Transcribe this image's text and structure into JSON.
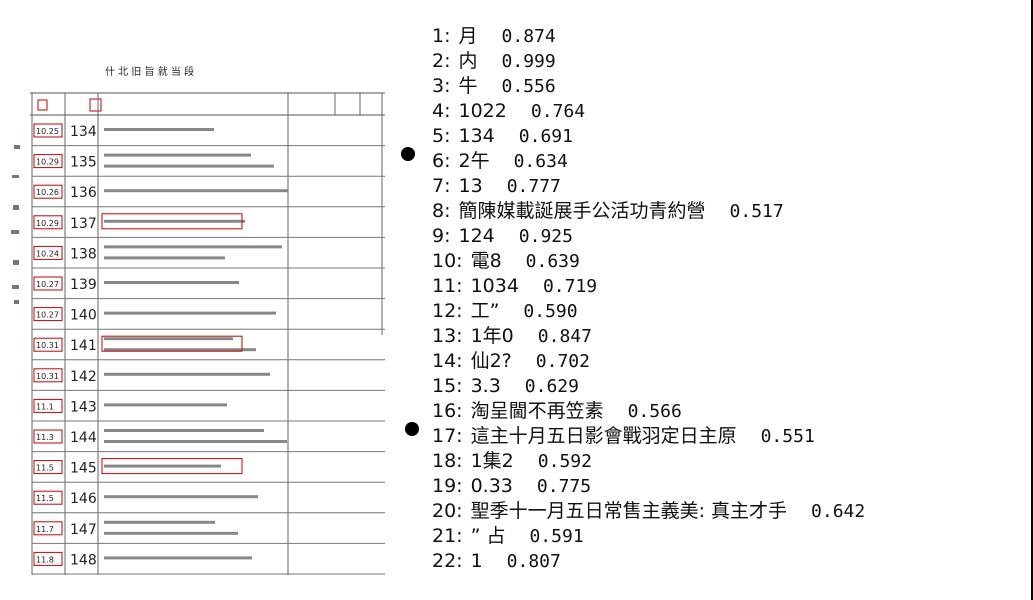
{
  "document": {
    "title_row": "什 北 旧 旨 就 当 段",
    "rows": [
      {
        "date": "10.25",
        "num": "134"
      },
      {
        "date": "10.29",
        "num": "135"
      },
      {
        "date": "10.26",
        "num": "136"
      },
      {
        "date": "10.29",
        "num": "137"
      },
      {
        "date": "10.24",
        "num": "138"
      },
      {
        "date": "10.27",
        "num": "139"
      },
      {
        "date": "10.27",
        "num": "140"
      },
      {
        "date": "10.31",
        "num": "141"
      },
      {
        "date": "10.31",
        "num": "142"
      },
      {
        "date": "11.1",
        "num": "143"
      },
      {
        "date": "11.3",
        "num": "144"
      },
      {
        "date": "11.5",
        "num": "145"
      },
      {
        "date": "11.5",
        "num": "146"
      },
      {
        "date": "11.7",
        "num": "147"
      },
      {
        "date": "11.8",
        "num": "148"
      }
    ]
  },
  "results": [
    {
      "idx": "1:",
      "text": "月",
      "score": "0.874"
    },
    {
      "idx": "2:",
      "text": "内",
      "score": "0.999"
    },
    {
      "idx": "3:",
      "text": "牛",
      "score": "0.556"
    },
    {
      "idx": "4:",
      "text": "1022",
      "score": "0.764"
    },
    {
      "idx": "5:",
      "text": "134",
      "score": "0.691"
    },
    {
      "idx": "6:",
      "text": "2午",
      "score": "0.634"
    },
    {
      "idx": "7:",
      "text": "13",
      "score": "0.777"
    },
    {
      "idx": "8:",
      "text": "簡陳媒載誕展手公活功青約營",
      "score": "0.517"
    },
    {
      "idx": "9:",
      "text": "124",
      "score": "0.925"
    },
    {
      "idx": "10:",
      "text": "電8",
      "score": "0.639"
    },
    {
      "idx": "11:",
      "text": "1034",
      "score": "0.719"
    },
    {
      "idx": "12:",
      "text": "工”",
      "score": "0.590"
    },
    {
      "idx": "13:",
      "text": "1年0",
      "score": "0.847"
    },
    {
      "idx": "14:",
      "text": "仙2?",
      "score": "0.702"
    },
    {
      "idx": "15:",
      "text": "3.3",
      "score": "0.629"
    },
    {
      "idx": "16:",
      "text": "淘呈閫不再笠素",
      "score": "0.566"
    },
    {
      "idx": "17:",
      "text": "這主十月五日影會戰羽定日主原",
      "score": "0.551"
    },
    {
      "idx": "18:",
      "text": "1集2",
      "score": "0.592"
    },
    {
      "idx": "19:",
      "text": "0.33",
      "score": "0.775"
    },
    {
      "idx": "20:",
      "text": "聖季十一月五日常售主義美: 真主才手",
      "score": "0.642"
    },
    {
      "idx": "21:",
      "text": "” 占",
      "score": "0.591"
    },
    {
      "idx": "22:",
      "text": "1",
      "score": "0.807"
    }
  ]
}
